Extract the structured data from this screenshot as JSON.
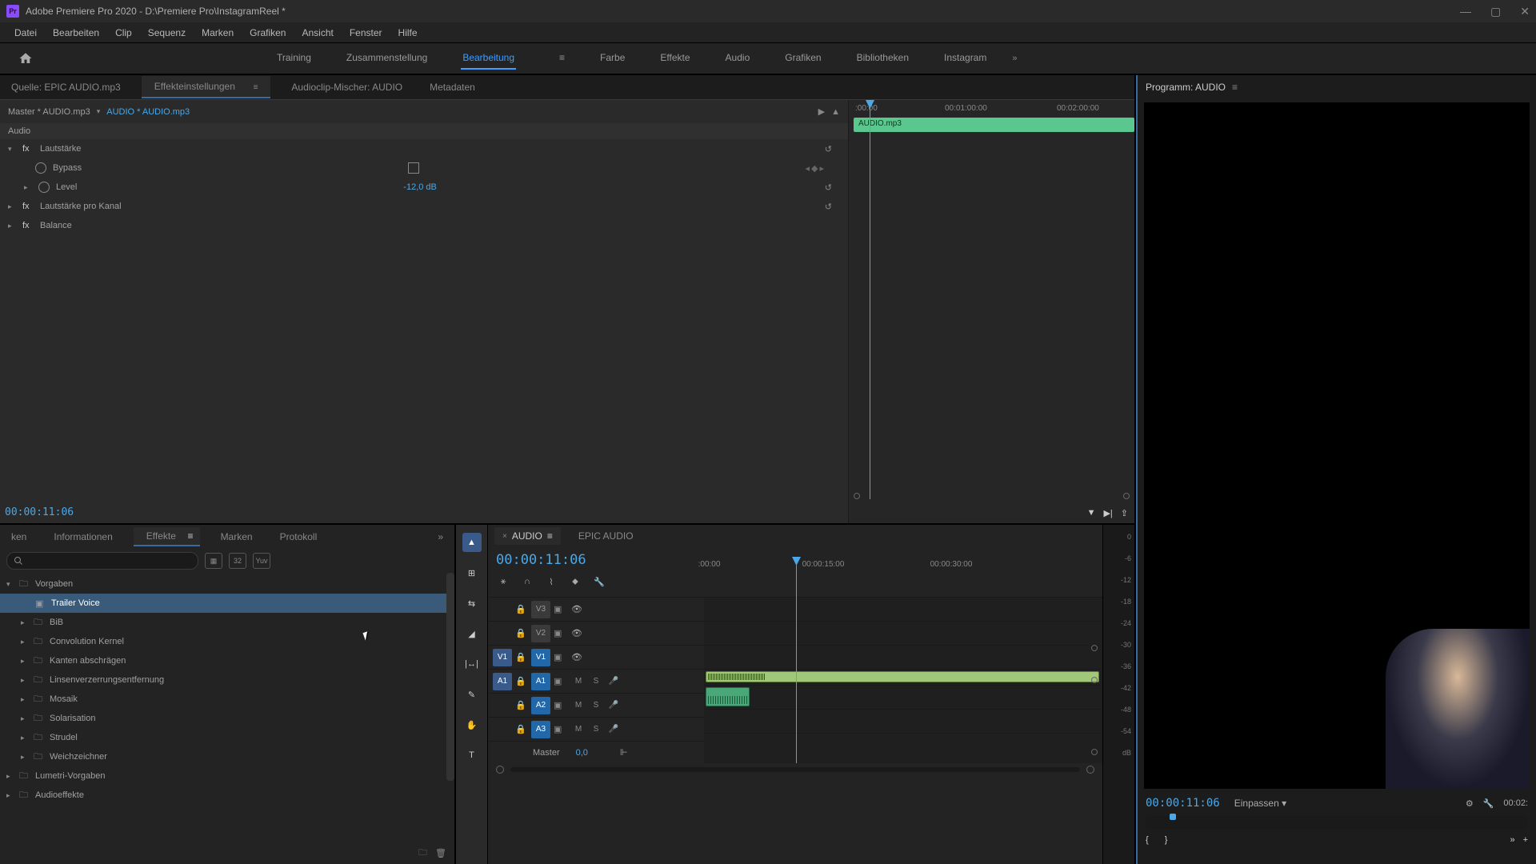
{
  "titlebar": {
    "app": "Adobe Premiere Pro 2020",
    "project": "D:\\Premiere Pro\\InstagramReel *"
  },
  "menu": [
    "Datei",
    "Bearbeiten",
    "Clip",
    "Sequenz",
    "Marken",
    "Grafiken",
    "Ansicht",
    "Fenster",
    "Hilfe"
  ],
  "workspaces": {
    "items": [
      "Training",
      "Zusammenstellung",
      "Bearbeitung",
      "Farbe",
      "Effekte",
      "Audio",
      "Grafiken",
      "Bibliotheken",
      "Instagram"
    ],
    "active": "Bearbeitung"
  },
  "sourceTabs": {
    "items": [
      "Quelle: EPIC AUDIO.mp3",
      "Effekteinstellungen",
      "Audioclip-Mischer: AUDIO",
      "Metadaten"
    ],
    "active": "Effekteinstellungen"
  },
  "effectSettings": {
    "master": "Master * AUDIO.mp3",
    "clip": "AUDIO * AUDIO.mp3",
    "section": "Audio",
    "props": {
      "lautstaerke": "Lautstärke",
      "bypass": "Bypass",
      "level": "Level",
      "levelValue": "-12,0 dB",
      "lautstaerkeKanal": "Lautstärke pro Kanal",
      "balance": "Balance"
    },
    "ruler": {
      "t0": ":00:00",
      "t1": "00:01:00:00",
      "t2": "00:02:00:00"
    },
    "clipLabel": "AUDIO.mp3",
    "timecode": "00:00:11:06"
  },
  "projectTabs": {
    "items": [
      "ken",
      "Informationen",
      "Effekte",
      "Marken",
      "Protokoll"
    ],
    "active": "Effekte"
  },
  "effectsTree": [
    {
      "label": "Vorgaben",
      "level": 0,
      "expanded": true
    },
    {
      "label": "Trailer Voice",
      "level": 1,
      "selected": true
    },
    {
      "label": "BiB",
      "level": 1
    },
    {
      "label": "Convolution Kernel",
      "level": 1
    },
    {
      "label": "Kanten abschrägen",
      "level": 1
    },
    {
      "label": "Linsenverzerrungsentfernung",
      "level": 1
    },
    {
      "label": "Mosaik",
      "level": 1
    },
    {
      "label": "Solarisation",
      "level": 1
    },
    {
      "label": "Strudel",
      "level": 1
    },
    {
      "label": "Weichzeichner",
      "level": 1
    },
    {
      "label": "Lumetri-Vorgaben",
      "level": 0
    },
    {
      "label": "Audioeffekte",
      "level": 0
    }
  ],
  "timeline": {
    "tabs": [
      {
        "label": "AUDIO",
        "active": true
      },
      {
        "label": "EPIC AUDIO",
        "active": false
      }
    ],
    "timecode": "00:00:11:06",
    "ruler": {
      "t0": ":00:00",
      "t1": "00:00:15:00",
      "t2": "00:00:30:00"
    },
    "videoTracks": [
      "V3",
      "V2",
      "V1"
    ],
    "audioTracks": [
      "A1",
      "A2",
      "A3"
    ],
    "sourceV": "V1",
    "sourceA": "A1",
    "master": {
      "label": "Master",
      "value": "0,0"
    },
    "track_m": "M",
    "track_s": "S"
  },
  "meters": {
    "labels": [
      "0",
      "-6",
      "-12",
      "-18",
      "-24",
      "-30",
      "-36",
      "-42",
      "-48",
      "-54",
      "dB"
    ]
  },
  "program": {
    "title": "Programm: AUDIO",
    "timecode": "00:00:11:06",
    "fit": "Einpassen",
    "duration": "00:02:"
  }
}
